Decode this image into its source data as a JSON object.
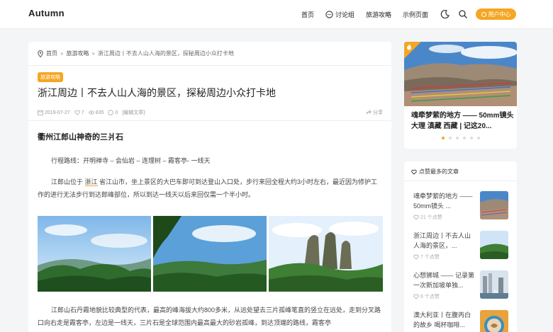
{
  "header": {
    "logo": "Autumn",
    "nav": [
      {
        "label": "首页",
        "icon": ""
      },
      {
        "label": "讨论组",
        "icon": "chat-icon"
      },
      {
        "label": "旅游攻略",
        "icon": ""
      },
      {
        "label": "示例页面",
        "icon": ""
      }
    ],
    "user_center": "用户中心"
  },
  "breadcrumb": {
    "home": "首页",
    "sep": "»",
    "category": "旅游攻略",
    "current": "浙江周边丨不去人山人海的景区，探秘周边小众打卡地"
  },
  "article": {
    "tag": "旅游攻略",
    "title": "浙江周边丨不去人山人海的景区，探秘周边小众打卡地",
    "meta": {
      "date": "2019-07-27",
      "likes": "7",
      "views": "835",
      "comments": "0",
      "edit": "[编辑文章]",
      "share": "分享"
    },
    "heading": "衢州江郎山神奇的三爿石",
    "route": "行程路线：开明禅寺 – 会仙岩 – 连理树 – 霞客亭- 一线天",
    "para1_pre": "江郎山位于 ",
    "para1_link": "浙江",
    "para1_post": " 省江山市，坐上景区的大巴车即可到达登山入口处，步行来回全程大约3小时左右，最近因为修护工作的进行无法步行到达郎峰部位，所以到达一线天以后来回仅需一个半小时。",
    "para2": "江郎山石丹霞地貌比较典型的代表，最高的峰海拔大约800多米，从远处望去三片孤峰笔直的竖立在远处，走到分叉路口向右走是霞客亭，左边是一线天，三片石是全球范围内最高最大的砂岩孤峰，到达顶端的路线，霞客亭"
  },
  "slider": {
    "title": "魂牵梦萦的地方 —— 50mm镜头 大理 滇藏 西藏 | 记这20...",
    "dots": 6,
    "active_dot": 0
  },
  "liked": {
    "heading": "点赞最多的文章",
    "items": [
      {
        "title": "魂牵梦萦的地方 —— 50mm镜头 ...",
        "likes": "21 个点赞",
        "thumb": "mountain-prayer-flags"
      },
      {
        "title": "浙江周边丨不去人山人海的景区，...",
        "likes": "7 个点赞",
        "thumb": "green-hills"
      },
      {
        "title": "心想狮城 —— 记录第一次新加坡单独...",
        "likes": "6 个点赞",
        "thumb": "singapore-merlion"
      },
      {
        "title": "澳大利亚丨在腹丙白的故乡 喝杯咖啡...",
        "likes": "",
        "thumb": "coffee-cup"
      }
    ]
  },
  "colors": {
    "accent": "#f5a623",
    "background": "#f4f5f6"
  }
}
